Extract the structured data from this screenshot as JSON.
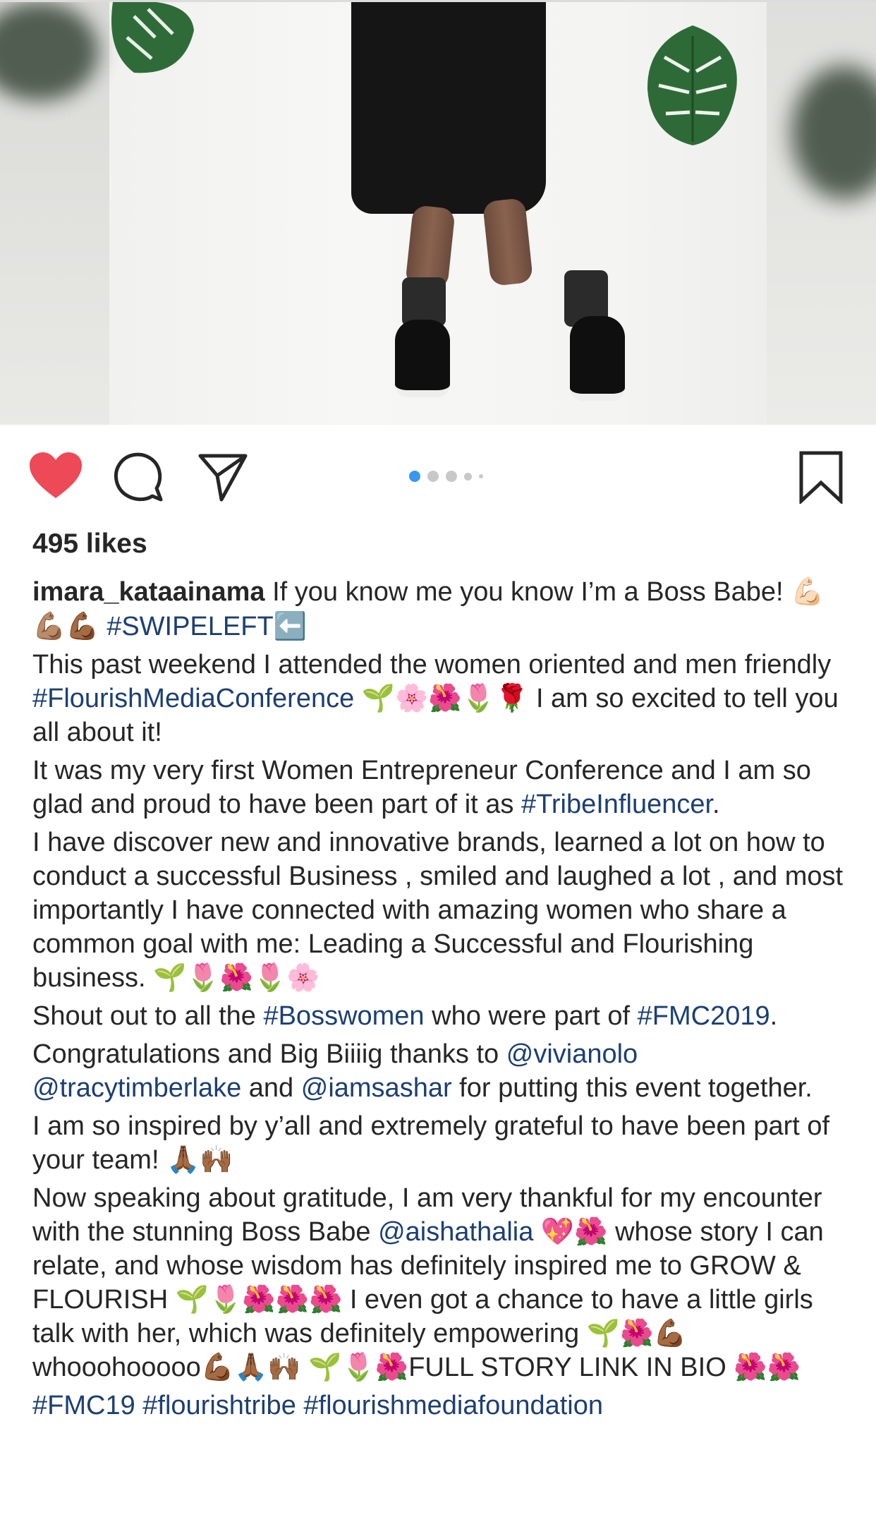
{
  "post": {
    "like_icon": "heart-filled-icon",
    "comment_icon": "comment-bubble-icon",
    "share_icon": "paper-plane-icon",
    "save_icon": "bookmark-icon",
    "carousel": {
      "count": 5,
      "active_index": 0
    },
    "likes_text": "495 likes",
    "username": "imara_kataainama",
    "colors": {
      "like": "#ed4956",
      "link": "#1c3f74",
      "dot_active": "#3897f0",
      "text": "#262626"
    }
  },
  "caption": {
    "p1": {
      "text": " If you know me you know I’m a Boss Babe! 💪🏻💪🏽💪🏾 ",
      "tag": "#SWIPELEFT",
      "emoji": "⬅️"
    },
    "p2": {
      "a": "This past weekend I attended the women oriented and men friendly ",
      "tag": "#FlourishMediaConference",
      "b": " 🌱🌸🌺🌷🌹 I am so excited to tell you all about it!"
    },
    "p3": {
      "a": "It was my very first Women Entrepreneur Conference and I am so glad and proud to have been part of it as ",
      "tag": "#TribeInfluencer",
      "b": "."
    },
    "p4": {
      "text": "I have discover new and innovative brands, learned a lot on how to conduct a successful Business , smiled and laughed a lot , and most importantly I have connected with amazing women who share a common goal with me: Leading a Successful and Flourishing business. 🌱🌷🌺🌷🌸"
    },
    "p5": {
      "a": "Shout out to all the ",
      "tag1": "#Bosswomen",
      "b": " who were part of ",
      "tag2": "#FMC2019",
      "c": "."
    },
    "p6": {
      "a": "Congratulations and Big Biiiig thanks to ",
      "m1": "@vivianolo",
      "m2": "@tracytimberlake",
      "b": " and ",
      "m3": "@iamsashar",
      "c": " for putting this event together."
    },
    "p7": {
      "text": "I am so inspired by y’all and extremely grateful to have been part of your team! 🙏🏾🙌🏾"
    },
    "p8": {
      "a": "Now speaking about gratitude, I am very thankful for my encounter with the stunning Boss Babe ",
      "m1": "@aishathalia",
      "b": " 💖🌺 whose story I can relate, and whose wisdom has definitely inspired me to GROW & FLOURISH 🌱🌷🌺🌺🌺 I even got a chance to have a little girls talk with her, which was definitely  empowering 🌱🌺💪🏾whooohooooo💪🏾🙏🏾🙌🏾 🌱🌷🌺FULL STORY LINK IN BIO 🌺🌺"
    },
    "p9": {
      "tags": "#FMC19 #flourishtribe #flourishmediafoundation"
    }
  }
}
